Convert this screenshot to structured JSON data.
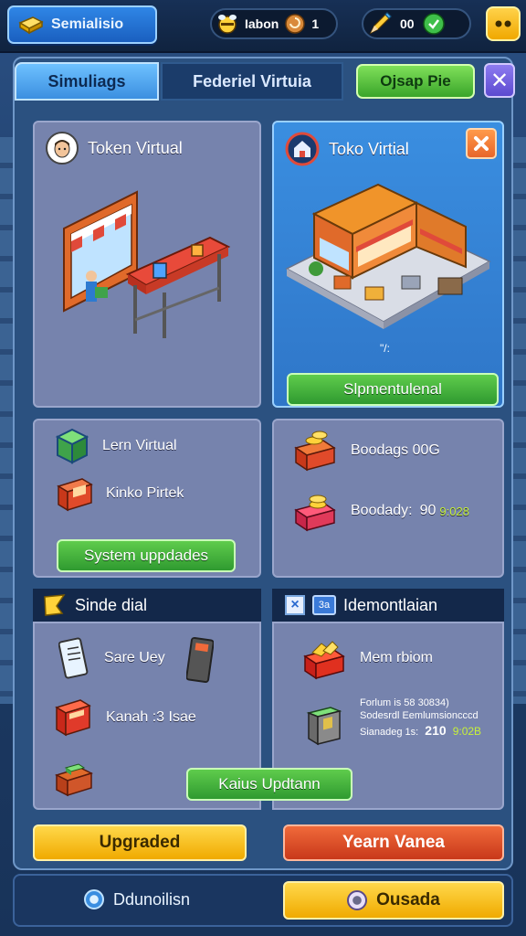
{
  "topbar": {
    "brand_label": "Semialisio",
    "resource1_label": "Iabon",
    "resource1_value": "1",
    "resource2_value": "00"
  },
  "tabs": {
    "tab1_label": "Simuliags",
    "tab2_label": "Federiel Virtuia",
    "open_button_label": "Ojsap Pie",
    "close_label": "✕"
  },
  "cards": {
    "token_virtual_title": "Token Virtual",
    "toko_virtual_title": "Toko Virtial",
    "toko_caption": "\"/:",
    "toko_button_label": "Slpmentulenal",
    "learn_virtual_label": "Lern Virtual",
    "kinko_label": "Kinko Pirtek",
    "system_button_label": "System uppdades",
    "boodags_label": "Boodags 00G",
    "boodady_label": "Boodady:",
    "boodady_value": "90",
    "boodady_accent": "9:028"
  },
  "lower": {
    "left_header": "Sinde dial",
    "right_header": "Idemontlaian",
    "right_badge": "3a",
    "sare_label": "Sare Uey",
    "kanah_label": "Kanah :3 Isae",
    "mem_label": "Mem rbiom",
    "small_line1": "Forlum is 58 30834)",
    "small_line2": "Sodesrdl Eemlumsioncccd",
    "small_line3": "Sianadeg 1s:",
    "small_value": "210",
    "small_accent": "9:02B",
    "kaius_button_label": "Kaius Updtann"
  },
  "actions": {
    "upgrade_label": "Upgraded",
    "yearn_label": "Yearn Vanea"
  },
  "bottom": {
    "option1_label": "Ddunoilisn",
    "option2_label": "Ousada"
  },
  "colors": {
    "accent_green": "#c7f03a",
    "panel_blue": "#2b5180",
    "card_grey": "#7683ad"
  }
}
